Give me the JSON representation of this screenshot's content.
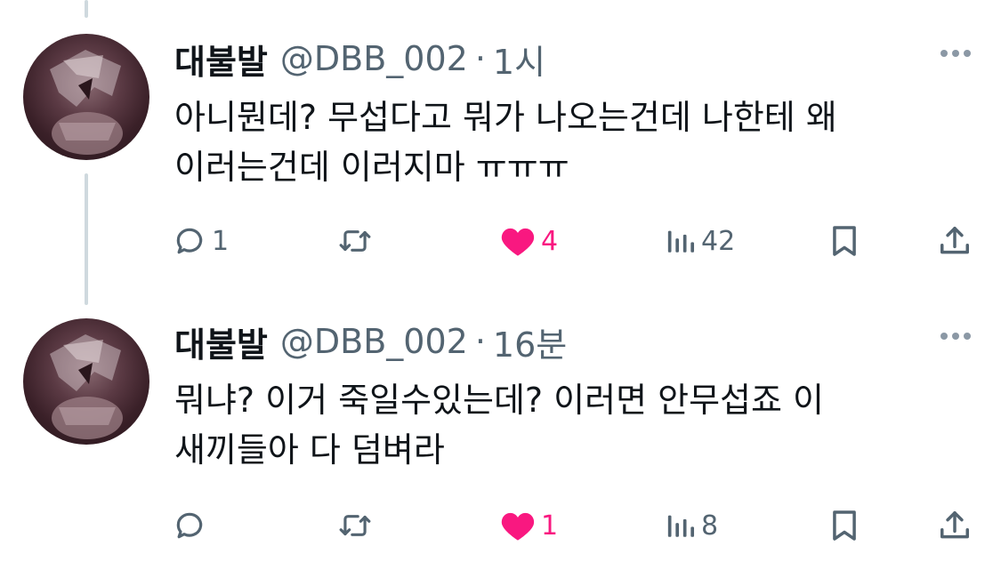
{
  "tweets": [
    {
      "display_name": "대불발",
      "handle": "@DBB_002",
      "separator": "·",
      "time": "1시",
      "text": "아니뭔데? 무섭다고 뭐가 나오는건데 나한테 왜\n이러는건데 이러지마 ㅠㅠㅠ",
      "actions": {
        "reply_count": "1",
        "repost_count": "",
        "like_count": "4",
        "liked": true,
        "views_count": "42"
      }
    },
    {
      "display_name": "대불발",
      "handle": "@DBB_002",
      "separator": "·",
      "time": "16분",
      "text": "뭐냐? 이거 죽일수있는데? 이러면 안무섭죠 이\n새끼들아 다 덤벼라",
      "actions": {
        "reply_count": "",
        "repost_count": "",
        "like_count": "1",
        "liked": true,
        "views_count": "8"
      }
    }
  ],
  "icons": {
    "reply": "reply-bubble-icon",
    "repost": "repost-arrows-icon",
    "like": "heart-icon",
    "views": "views-bar-chart-icon",
    "bookmark": "bookmark-icon",
    "share": "share-upload-icon",
    "more": "more-dots-icon"
  },
  "colors": {
    "text_primary": "#0f1419",
    "text_secondary": "#536471",
    "like_active": "#f91880",
    "thread_line": "#cfd9de"
  }
}
